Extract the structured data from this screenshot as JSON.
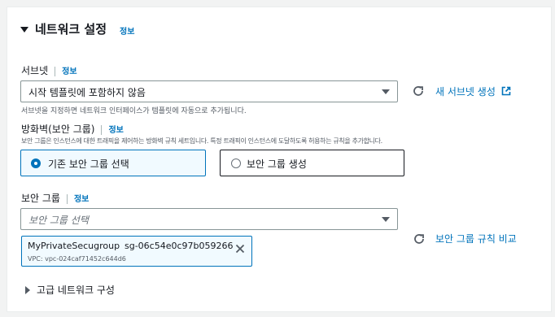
{
  "section": {
    "title": "네트워크 설정",
    "info": "정보"
  },
  "subnet": {
    "label": "서브넷",
    "info": "정보",
    "selected": "시작 템플릿에 포함하지 않음",
    "hint": "서브넷을 지정하면 네트워크 인터페이스가 템플릿에 자동으로 추가됩니다.",
    "new_link": "새 서브넷 생성"
  },
  "firewall": {
    "label": "방화벽(보안 그룹)",
    "info": "정보",
    "hint": "보안 그룹은 인스턴스에 대한 트래픽을 제어하는 방화벽 규칙 세트입니다. 특정 트래픽이 인스턴스에 도달하도록 허용하는 규칙을 추가합니다.",
    "options": [
      {
        "label": "기존 보안 그룹 선택",
        "selected": true
      },
      {
        "label": "보안 그룹 생성",
        "selected": false
      }
    ]
  },
  "security_group": {
    "label": "보안 그룹",
    "info": "정보",
    "placeholder": "보안 그룹 선택",
    "compare_link": "보안 그룹 규칙 비교",
    "token": {
      "name": "MyPrivateSecugroup",
      "id": "sg-06c54e0c97b059266",
      "vpc": "VPC: vpc-024caf71452c644d6"
    }
  },
  "advanced": {
    "label": "고급 네트워크 구성"
  },
  "colors": {
    "accent": "#0073bb",
    "selected_bg": "#f1faff",
    "border": "#879596"
  }
}
